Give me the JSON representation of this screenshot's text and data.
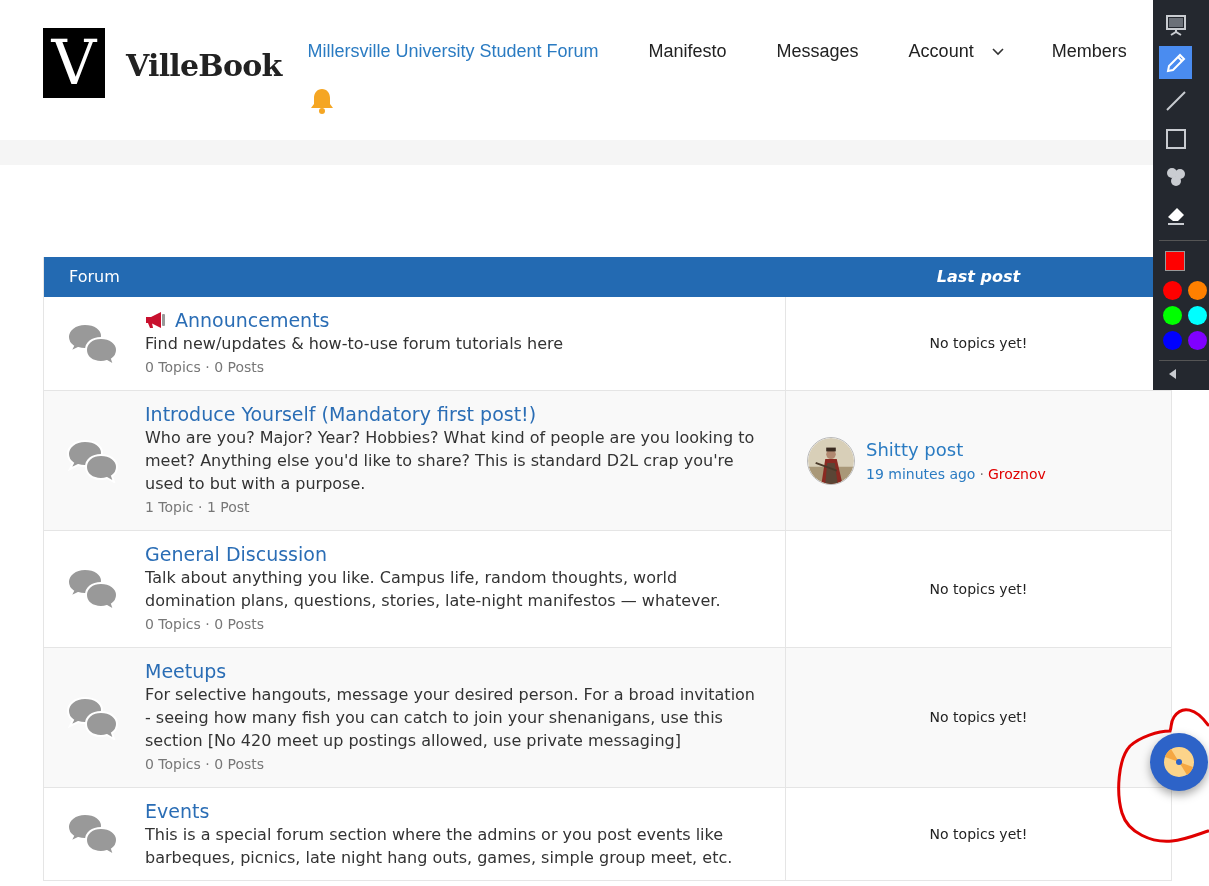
{
  "header": {
    "logo_letter": "V",
    "brand": "VilleBook",
    "site_link": "Millersville University Student Forum",
    "nav": [
      {
        "label": "Manifesto",
        "kind": "link"
      },
      {
        "label": "Messages",
        "kind": "link"
      },
      {
        "label": "Account",
        "kind": "dropdown"
      },
      {
        "label": "Members",
        "kind": "link"
      }
    ]
  },
  "table": {
    "columns": [
      "Forum",
      "Last post"
    ],
    "rows": [
      {
        "kind": "announcement",
        "title": "Announcements",
        "description": "Find new/updates & how-to-use forum tutorials here",
        "counts": "0 Topics · 0 Posts",
        "last_post": {
          "kind": "empty",
          "text": "No topics yet!"
        }
      },
      {
        "kind": "plain",
        "title": "Introduce Yourself (Mandatory first post!)",
        "description": "Who are you? Major? Year? Hobbies? What kind of people are you looking to meet? Anything else you'd like to share? This is standard D2L crap you're used to but with a purpose.",
        "counts": "1 Topic · 1 Post",
        "last_post": {
          "kind": "post",
          "title": "Shitty post",
          "time": "19 minutes ago",
          "separator": "·",
          "author": "Groznov"
        }
      },
      {
        "kind": "plain",
        "title": "General Discussion",
        "description": "Talk about anything you like. Campus life, random thoughts, world domination plans, questions, stories, late-night manifestos — whatever.",
        "counts": "0 Topics · 0 Posts",
        "last_post": {
          "kind": "empty",
          "text": "No topics yet!"
        }
      },
      {
        "kind": "plain",
        "title": "Meetups",
        "description": "For selective hangouts, message your desired person. For a broad invitation - seeing how many fish you can catch to join your shenanigans, use this section [No 420 meet up postings allowed, use private messaging]",
        "counts": "0 Topics · 0 Posts",
        "last_post": {
          "kind": "empty",
          "text": "No topics yet!"
        }
      },
      {
        "kind": "plain",
        "title": "Events",
        "description": "This is a special forum section where the admins or you post events like barbeques, picnics, late night hang outs, games, simple group meet, etc.",
        "last_post": {
          "kind": "empty",
          "text": "No topics yet!"
        }
      }
    ]
  },
  "annotation_toolbar": {
    "tools": [
      {
        "kind": "presentation",
        "selected": false
      },
      {
        "kind": "pencil",
        "selected": true
      },
      {
        "kind": "line",
        "selected": false
      },
      {
        "kind": "rectangle",
        "selected": false
      },
      {
        "kind": "numbers",
        "selected": false
      },
      {
        "kind": "eraser",
        "selected": false
      }
    ],
    "current_swatch": {
      "color": "#ff0000"
    },
    "swatches": [
      {
        "color": "#ff0000"
      },
      {
        "color": "#ff8000"
      },
      {
        "color": "#00ff00"
      },
      {
        "color": "#00ffff"
      },
      {
        "color": "#0000ff"
      },
      {
        "color": "#8000ff"
      }
    ]
  }
}
